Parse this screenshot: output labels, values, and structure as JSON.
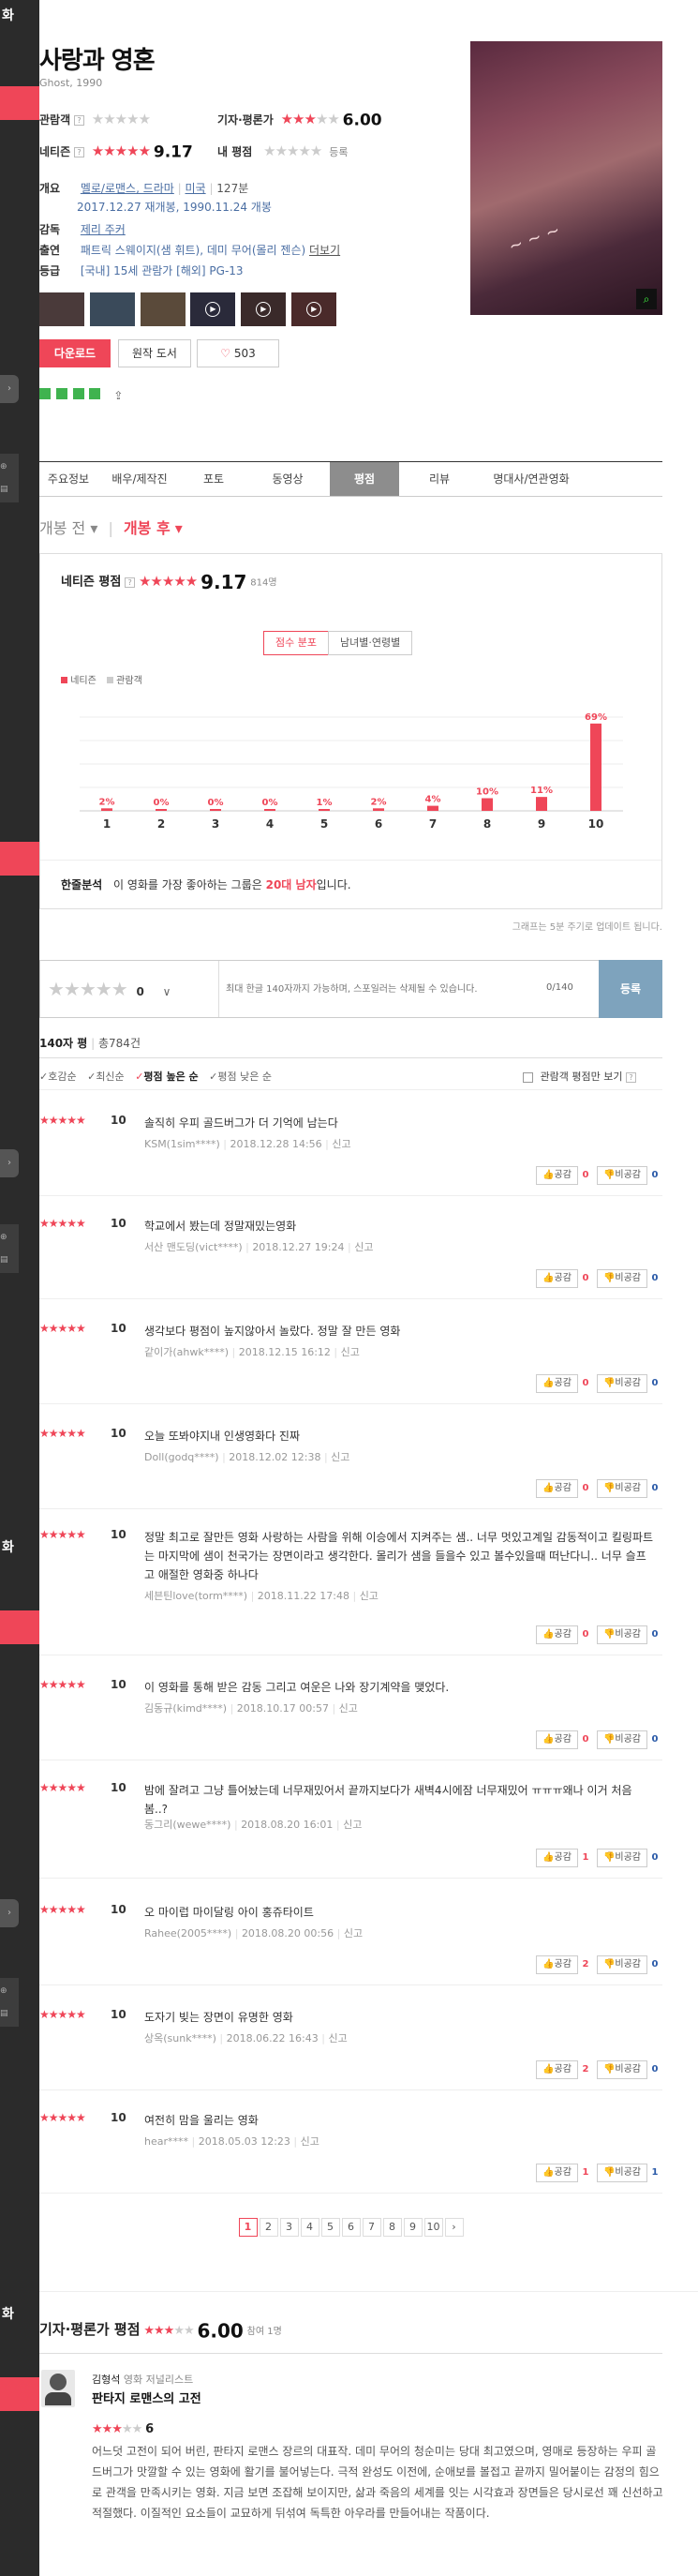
{
  "sidebar": {
    "labels": [
      "화",
      "화",
      "화"
    ]
  },
  "movie": {
    "title": "사랑과 영혼",
    "subtitle": "Ghost, 1990",
    "audience_label": "관람객",
    "critic_label": "기자·평론가",
    "critic_score": "6.00",
    "netizen_label": "네티즌",
    "netizen_score": "9.17",
    "my_label": "내 평점",
    "my_register": "등록",
    "overview_label": "개요",
    "genre": "멜로/로맨스, 드라마",
    "country": "미국",
    "runtime": "127분",
    "release": "2017.12.27 재개봉, 1990.11.24 개봉",
    "director_label": "감독",
    "director": "제리 주커",
    "cast_label": "출연",
    "cast": "패트릭 스웨이지(샘 휘트), 데미 무어(몰리 젠슨)",
    "cast_more": "더보기",
    "grade_label": "등급",
    "grade": "[국내] 15세 관람가 [해외] PG-13",
    "download": "다운로드",
    "original_book": "원작 도서",
    "like_count": "503"
  },
  "tabs": [
    "주요정보",
    "배우/제작진",
    "포토",
    "동영상",
    "평점",
    "리뷰",
    "명대사/연관영화"
  ],
  "rating_tabs": {
    "before": "개봉 전",
    "after": "개봉 후"
  },
  "netizen_box": {
    "label": "네티즌 평점",
    "score": "9.17",
    "count": "814명",
    "btn_dist": "점수 분포",
    "btn_gender": "남녀별·연령별",
    "legend_netizen": "네티즌",
    "legend_audience": "관람객",
    "analysis_label": "한줄분석",
    "analysis_text_pre": "이 영화를 가장 좋아하는 그룹은",
    "analysis_highlight": "20대 남자",
    "analysis_text_post": "입니다.",
    "graph_note": "그래프는 5분 주기로 업데이트 됩니다."
  },
  "chart_data": {
    "type": "bar",
    "categories": [
      "1",
      "2",
      "3",
      "4",
      "5",
      "6",
      "7",
      "8",
      "9",
      "10"
    ],
    "series": [
      {
        "name": "네티즌",
        "values": [
          2,
          0,
          0,
          0,
          1,
          2,
          4,
          10,
          11,
          69
        ]
      }
    ],
    "value_labels": [
      "2%",
      "0%",
      "0%",
      "0%",
      "1%",
      "2%",
      "4%",
      "10%",
      "11%",
      "69%"
    ],
    "ylim": [
      0,
      100
    ],
    "grid": true,
    "colors": {
      "netizen": "#ef4658",
      "audience": "#cccccc"
    }
  },
  "write": {
    "score": "0",
    "placeholder": "최대 한글 140자까지 가능하며, 스포일러는 삭제될 수 있습니다.",
    "counter": "0/140",
    "submit": "등록"
  },
  "list_header": {
    "label": "140자 평",
    "total": "총784건"
  },
  "sort": {
    "likes": "호감순",
    "latest": "최신순",
    "high": "평점 높은 순",
    "low": "평점 낮은 순",
    "audience_only": "관람객 평점만 보기"
  },
  "reviews": [
    {
      "score": "10",
      "text": "솔직히 우피 골드버그가 더 기억에 남는다",
      "user": "KSM(1sim****)",
      "date": "2018.12.28 14:56",
      "like": "0",
      "dislike": "0"
    },
    {
      "score": "10",
      "text": "학교에서 봤는데 정말재밌는영화",
      "user": "서산 맨도딩(vict****)",
      "date": "2018.12.27 19:24",
      "like": "0",
      "dislike": "0"
    },
    {
      "score": "10",
      "text": "생각보다 평점이 높지않아서 놀랐다. 정말 잘 만든 영화",
      "user": "같이가(ahwk****)",
      "date": "2018.12.15 16:12",
      "like": "0",
      "dislike": "0"
    },
    {
      "score": "10",
      "text": "오늘 또봐야지내 인생영화다 진짜",
      "user": "Doll(godq****)",
      "date": "2018.12.02 12:38",
      "like": "0",
      "dislike": "0"
    },
    {
      "score": "10",
      "text": "정말 최고로 잘만든 영화 사랑하는 사람을 위해 이승에서 지켜주는 샘.. 너무 멋있고계일 감동적이고 킬링파트는 마지막에 샘이 천국가는 장면이라고 생각한다. 몰리가 샘을 들을수 있고 볼수있을때 떠난다니.. 너무 슬프고 애절한 영화중 하나다",
      "user": "세븐틴love(torm****)",
      "date": "2018.11.22 17:48",
      "like": "0",
      "dislike": "0"
    },
    {
      "score": "10",
      "text": "이 영화를 통해 받은 감동 그리고 여운은 나와 장기계약을 맺었다.",
      "user": "김동규(kimd****)",
      "date": "2018.10.17 00:57",
      "like": "0",
      "dislike": "0"
    },
    {
      "score": "10",
      "text": "밤에 잘려고 그냥 틀어놨는데 너무재밌어서 끝까지보다가 새벽4시에잠 너무재밌어 ㅠㅠㅠ왜나 이거 처음봄..?",
      "user": "동그리(wewe****)",
      "date": "2018.08.20 16:01",
      "like": "1",
      "dislike": "0"
    },
    {
      "score": "10",
      "text": "오 마이럽 마이달링 아이 홍쥬타이트",
      "user": "Rahee(2005****)",
      "date": "2018.08.20 00:56",
      "like": "2",
      "dislike": "0"
    },
    {
      "score": "10",
      "text": "도자기 빚는 장면이 유명한 영화",
      "user": "상옥(sunk****)",
      "date": "2018.06.22 16:43",
      "like": "2",
      "dislike": "0"
    },
    {
      "score": "10",
      "text": "여전히 맘을 울리는 영화",
      "user": "hear****",
      "date": "2018.05.03 12:23",
      "like": "1",
      "dislike": "1"
    }
  ],
  "report": "신고",
  "like_label": "공감",
  "dislike_label": "비공감",
  "pages": [
    "1",
    "2",
    "3",
    "4",
    "5",
    "6",
    "7",
    "8",
    "9",
    "10"
  ],
  "critic_section": {
    "title": "기자·평론가 평점",
    "score": "6.00",
    "count": "참여 1명",
    "name": "김형석",
    "role": "영화 저널리스트",
    "headline": "판타지 로맨스의 고전",
    "review_score": "6",
    "text": "어느덧 고전이 되어 버린, 판타지 로맨스 장르의 대표작. 데미 무어의 청순미는 당대 최고였으며, 영매로 등장하는 우피 골드버그가 맛깔할 수 있는 영화에 활기를 불어넣는다. 극적 완성도 이전에, 순애보를 볼접고 끝까지 밀어붙이는 감정의 힘으로 관객을 만족시키는 영화. 지금 보면 조잡해 보이지만, 삶과 죽음의 세계를 잇는 시각효과 장면들은 당시로선 꽤 신선하고 적절했다. 이질적인 요소들이 교묘하게 뒤섞여 독특한 아우라를 만들어내는 작품이다."
  }
}
